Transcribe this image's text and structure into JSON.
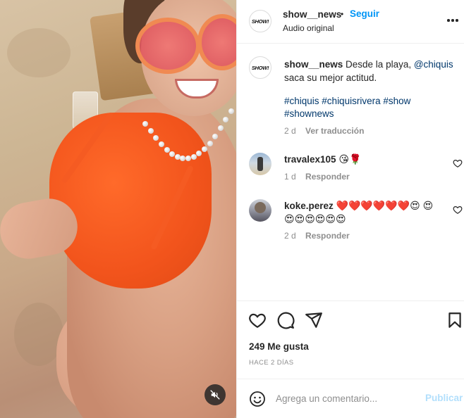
{
  "post": {
    "username": "show__news",
    "separator": "•",
    "follow_label": "Seguir",
    "audio_label": "Audio original",
    "avatar_logo": "SHOW!",
    "caption_text": " Desde la playa, ",
    "caption_mention": "@chiquis",
    "caption_rest": " saca su mejor actitud.",
    "hashtags": [
      "#chiquis",
      "#chiquisrivera",
      "#show",
      "#shownews"
    ],
    "caption_time": "2 d",
    "translate_label": "Ver traducción"
  },
  "comments": [
    {
      "username": "travalex105",
      "text": "😘🌹",
      "time": "1 d",
      "reply_label": "Responder"
    },
    {
      "username": "koke.perez",
      "text": "❤️❤️❤️❤️❤️❤️😍 😍😍😍😍😍😍😍",
      "time": "2 d",
      "reply_label": "Responder"
    }
  ],
  "footer": {
    "likes": "249 Me gusta",
    "time_ago": "HACE 2 DÍAS",
    "comment_placeholder": "Agrega un comentario...",
    "publish_label": "Publicar"
  },
  "icons": {
    "like": "heart-icon",
    "comment": "comment-icon",
    "share": "send-icon",
    "save": "bookmark-icon",
    "more": "more-options-icon",
    "mute": "muted-audio-icon",
    "emoji": "emoji-icon"
  },
  "colors": {
    "follow": "#0095f6",
    "publish_disabled": "#b2dffc",
    "muted_text": "#8e8e8e",
    "hashtag": "#00376b"
  }
}
